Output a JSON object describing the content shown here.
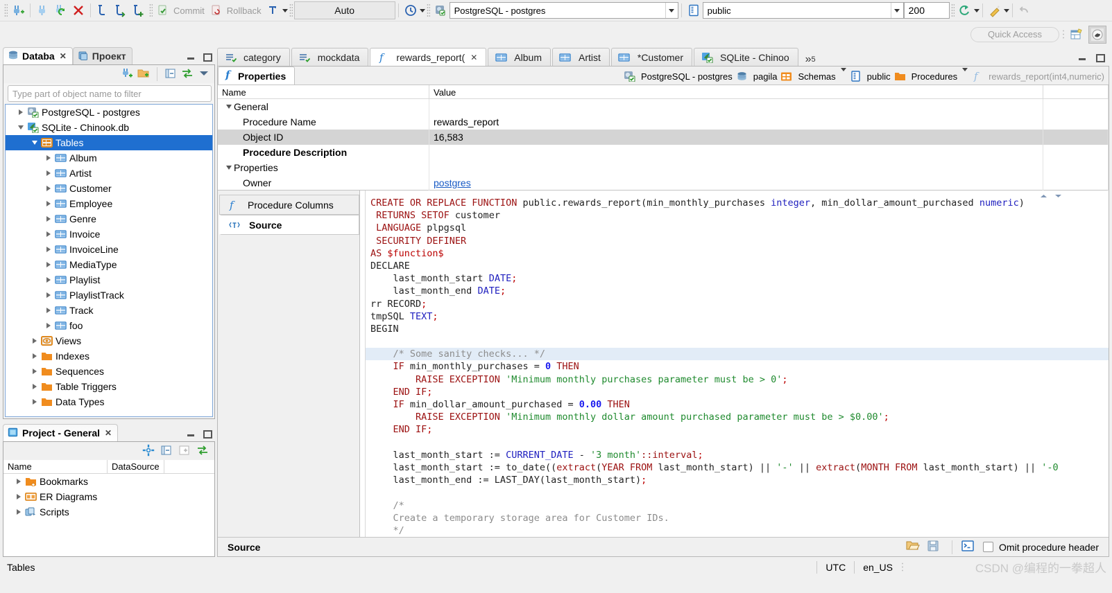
{
  "toolbar": {
    "icons": [
      "new-connection-icon",
      "connect-icon",
      "refresh-connection-icon",
      "disconnect-icon",
      "sql-editor-icon",
      "sql-editor-open-icon",
      "sql-editor-new-icon"
    ],
    "commit_label": "Commit",
    "rollback_label": "Rollback",
    "transaction_mode_icon": "transaction-mode-icon",
    "auto_commit_label": "Auto",
    "history_icon": "transaction-log-icon",
    "connection_value": "PostgreSQL - postgres",
    "schema_value": "public",
    "fetch_size_value": "200",
    "refresh_icon": "refresh-icon",
    "tools_icon": "tools-icon",
    "undo_icon": "undo-icon"
  },
  "quick_access": {
    "placeholder": "Quick Access",
    "open_perspective_icon": "open-perspective-icon",
    "perspective_icon": "dbeaver-perspective-icon"
  },
  "navigator": {
    "tabs": [
      {
        "label": "Databa",
        "icon": "database-navigator-icon",
        "active": true,
        "closable": true
      },
      {
        "label": "Проект",
        "icon": "project-explorer-icon",
        "active": false,
        "closable": false
      }
    ],
    "tools": [
      "new-connection-icon",
      "new-folder-icon",
      "collapse-all-icon",
      "link-with-editor-icon",
      "view-menu-icon"
    ],
    "filter_placeholder": "Type part of object name to filter",
    "tree": [
      {
        "label": "PostgreSQL - postgres",
        "indent": 0,
        "twisty": "right",
        "icon": "postgresql-connection-icon",
        "selected": false
      },
      {
        "label": "SQLite - Chinook.db",
        "indent": 0,
        "twisty": "down",
        "icon": "sqlite-connection-icon",
        "selected": false
      },
      {
        "label": "Tables",
        "indent": 1,
        "twisty": "down",
        "icon": "tables-folder-icon",
        "selected": true
      },
      {
        "label": "Album",
        "indent": 2,
        "twisty": "right",
        "icon": "table-icon",
        "selected": false
      },
      {
        "label": "Artist",
        "indent": 2,
        "twisty": "right",
        "icon": "table-icon",
        "selected": false
      },
      {
        "label": "Customer",
        "indent": 2,
        "twisty": "right",
        "icon": "table-icon",
        "selected": false
      },
      {
        "label": "Employee",
        "indent": 2,
        "twisty": "right",
        "icon": "table-icon",
        "selected": false
      },
      {
        "label": "Genre",
        "indent": 2,
        "twisty": "right",
        "icon": "table-icon",
        "selected": false
      },
      {
        "label": "Invoice",
        "indent": 2,
        "twisty": "right",
        "icon": "table-icon",
        "selected": false
      },
      {
        "label": "InvoiceLine",
        "indent": 2,
        "twisty": "right",
        "icon": "table-icon",
        "selected": false
      },
      {
        "label": "MediaType",
        "indent": 2,
        "twisty": "right",
        "icon": "table-icon",
        "selected": false
      },
      {
        "label": "Playlist",
        "indent": 2,
        "twisty": "right",
        "icon": "table-icon",
        "selected": false
      },
      {
        "label": "PlaylistTrack",
        "indent": 2,
        "twisty": "right",
        "icon": "table-icon",
        "selected": false
      },
      {
        "label": "Track",
        "indent": 2,
        "twisty": "right",
        "icon": "table-icon",
        "selected": false
      },
      {
        "label": "foo",
        "indent": 2,
        "twisty": "right",
        "icon": "table-icon",
        "selected": false
      },
      {
        "label": "Views",
        "indent": 1,
        "twisty": "right",
        "icon": "views-folder-icon",
        "selected": false
      },
      {
        "label": "Indexes",
        "indent": 1,
        "twisty": "right",
        "icon": "folder-icon",
        "selected": false
      },
      {
        "label": "Sequences",
        "indent": 1,
        "twisty": "right",
        "icon": "folder-icon",
        "selected": false
      },
      {
        "label": "Table Triggers",
        "indent": 1,
        "twisty": "right",
        "icon": "folder-icon",
        "selected": false
      },
      {
        "label": "Data Types",
        "indent": 1,
        "twisty": "right",
        "icon": "folder-icon",
        "selected": false
      }
    ]
  },
  "project": {
    "tab_label": "Project - General",
    "tab_icon": "project-icon",
    "tools": [
      "settings-gear-icon",
      "collapse-all-icon",
      "expand-all-icon",
      "link-with-editor-icon"
    ],
    "columns": [
      "Name",
      "DataSource"
    ],
    "tree": [
      {
        "label": "Bookmarks",
        "icon": "bookmarks-folder-icon"
      },
      {
        "label": "ER Diagrams",
        "icon": "er-diagram-icon"
      },
      {
        "label": "Scripts",
        "icon": "scripts-icon"
      }
    ]
  },
  "editor": {
    "tabs": [
      {
        "label": "category",
        "icon": "sql-script-icon",
        "active": false,
        "closable": false
      },
      {
        "label": "mockdata",
        "icon": "sql-script-icon",
        "active": false,
        "closable": false
      },
      {
        "label": "rewards_report(",
        "icon": "function-icon",
        "active": true,
        "closable": true
      },
      {
        "label": "Album",
        "icon": "table-icon",
        "active": false,
        "closable": false
      },
      {
        "label": "Artist",
        "icon": "table-icon",
        "active": false,
        "closable": false
      },
      {
        "label": "*Customer",
        "icon": "table-icon",
        "active": false,
        "closable": false
      },
      {
        "label": "SQLite - Chinoo",
        "icon": "sqlite-connection-icon",
        "active": false,
        "closable": false
      }
    ],
    "overflow_label": "5",
    "sub_tab": {
      "label": "Properties",
      "icon": "function-icon"
    },
    "breadcrumbs": [
      {
        "label": "PostgreSQL - postgres",
        "icon": "postgresql-connection-icon",
        "dim": false,
        "menu": false
      },
      {
        "label": "pagila",
        "icon": "database-icon",
        "dim": false,
        "menu": false
      },
      {
        "label": "Schemas",
        "icon": "schemas-icon",
        "dim": false,
        "menu": true
      },
      {
        "label": "public",
        "icon": "schema-icon",
        "dim": false,
        "menu": false
      },
      {
        "label": "Procedures",
        "icon": "folder-icon",
        "dim": false,
        "menu": true
      },
      {
        "label": "rewards_report(int4,numeric)",
        "icon": "function-icon",
        "dim": true,
        "menu": false
      }
    ],
    "properties": {
      "columns": [
        "Name",
        "Value"
      ],
      "rows": [
        {
          "name": "General",
          "value": "",
          "kind": "section",
          "alt": false
        },
        {
          "name": "Procedure Name",
          "value": "rewards_report",
          "kind": "item",
          "alt": false
        },
        {
          "name": "Object ID",
          "value": "16,583",
          "kind": "item",
          "alt": true
        },
        {
          "name": "Procedure Description",
          "value": "",
          "kind": "bold",
          "alt": false
        },
        {
          "name": "Properties",
          "value": "",
          "kind": "section",
          "alt": false
        },
        {
          "name": "Owner",
          "value": "postgres",
          "kind": "link",
          "alt": false
        }
      ]
    },
    "side_tabs": [
      {
        "label": "Procedure Columns",
        "icon": "function-icon",
        "active": false
      },
      {
        "label": "Source",
        "icon": "source-text-icon",
        "active": true
      }
    ],
    "footer": {
      "label": "Source",
      "icons": [
        "load-from-file-icon",
        "save-to-file-icon",
        "open-in-console-icon"
      ],
      "checkbox_label": "Omit procedure header",
      "checkbox_checked": false
    },
    "source_lines": [
      {
        "hl": false,
        "spans": [
          {
            "t": "CREATE OR REPLACE FUNCTION ",
            "c": "kw"
          },
          {
            "t": "public.rewards_report(min_monthly_purchases ",
            "c": "id"
          },
          {
            "t": "integer",
            "c": "typ"
          },
          {
            "t": ", min_dollar_amount_purchased ",
            "c": "id"
          },
          {
            "t": "numeric",
            "c": "typ"
          },
          {
            "t": ")",
            "c": "id"
          }
        ]
      },
      {
        "hl": false,
        "spans": [
          {
            "t": " RETURNS SETOF ",
            "c": "kw"
          },
          {
            "t": "customer",
            "c": "id"
          }
        ]
      },
      {
        "hl": false,
        "spans": [
          {
            "t": " LANGUAGE ",
            "c": "kw"
          },
          {
            "t": "plpgsql",
            "c": "id"
          }
        ]
      },
      {
        "hl": false,
        "spans": [
          {
            "t": " SECURITY DEFINER",
            "c": "kw"
          }
        ]
      },
      {
        "hl": false,
        "spans": [
          {
            "t": "AS ",
            "c": "kw"
          },
          {
            "t": "$function$",
            "c": "pun"
          }
        ]
      },
      {
        "hl": false,
        "spans": [
          {
            "t": "DECLARE",
            "c": "id"
          }
        ]
      },
      {
        "hl": false,
        "spans": [
          {
            "t": "    last_month_start ",
            "c": "id"
          },
          {
            "t": "DATE",
            "c": "typ"
          },
          {
            "t": ";",
            "c": "pun"
          }
        ]
      },
      {
        "hl": false,
        "spans": [
          {
            "t": "    last_month_end ",
            "c": "id"
          },
          {
            "t": "DATE",
            "c": "typ"
          },
          {
            "t": ";",
            "c": "pun"
          }
        ]
      },
      {
        "hl": false,
        "spans": [
          {
            "t": "rr RECORD",
            "c": "id"
          },
          {
            "t": ";",
            "c": "pun"
          }
        ]
      },
      {
        "hl": false,
        "spans": [
          {
            "t": "tmpSQL ",
            "c": "id"
          },
          {
            "t": "TEXT",
            "c": "typ"
          },
          {
            "t": ";",
            "c": "pun"
          }
        ]
      },
      {
        "hl": false,
        "spans": [
          {
            "t": "BEGIN",
            "c": "id"
          }
        ]
      },
      {
        "hl": false,
        "spans": [
          {
            "t": "",
            "c": "id"
          }
        ]
      },
      {
        "hl": true,
        "spans": [
          {
            "t": "    /* Some sanity checks... */",
            "c": "cmt"
          }
        ]
      },
      {
        "hl": false,
        "spans": [
          {
            "t": "    IF ",
            "c": "kw"
          },
          {
            "t": "min_monthly_purchases = ",
            "c": "id"
          },
          {
            "t": "0",
            "c": "num"
          },
          {
            "t": " THEN",
            "c": "kw"
          }
        ]
      },
      {
        "hl": false,
        "spans": [
          {
            "t": "        RAISE EXCEPTION ",
            "c": "kw"
          },
          {
            "t": "'Minimum monthly purchases parameter must be > 0'",
            "c": "str"
          },
          {
            "t": ";",
            "c": "pun"
          }
        ]
      },
      {
        "hl": false,
        "spans": [
          {
            "t": "    END IF",
            "c": "kw"
          },
          {
            "t": ";",
            "c": "pun"
          }
        ]
      },
      {
        "hl": false,
        "spans": [
          {
            "t": "    IF ",
            "c": "kw"
          },
          {
            "t": "min_dollar_amount_purchased = ",
            "c": "id"
          },
          {
            "t": "0.00",
            "c": "num"
          },
          {
            "t": " THEN",
            "c": "kw"
          }
        ]
      },
      {
        "hl": false,
        "spans": [
          {
            "t": "        RAISE EXCEPTION ",
            "c": "kw"
          },
          {
            "t": "'Minimum monthly dollar amount purchased parameter must be > $0.00'",
            "c": "str"
          },
          {
            "t": ";",
            "c": "pun"
          }
        ]
      },
      {
        "hl": false,
        "spans": [
          {
            "t": "    END IF",
            "c": "kw"
          },
          {
            "t": ";",
            "c": "pun"
          }
        ]
      },
      {
        "hl": false,
        "spans": [
          {
            "t": "",
            "c": "id"
          }
        ]
      },
      {
        "hl": false,
        "spans": [
          {
            "t": "    last_month_start := ",
            "c": "id"
          },
          {
            "t": "CURRENT_DATE",
            "c": "typ"
          },
          {
            "t": " - ",
            "c": "id"
          },
          {
            "t": "'3 month'",
            "c": "str"
          },
          {
            "t": "::interval",
            "c": "kw"
          },
          {
            "t": ";",
            "c": "pun"
          }
        ]
      },
      {
        "hl": false,
        "spans": [
          {
            "t": "    last_month_start := to_date((",
            "c": "id"
          },
          {
            "t": "extract",
            "c": "kw"
          },
          {
            "t": "(",
            "c": "id"
          },
          {
            "t": "YEAR FROM",
            "c": "kw"
          },
          {
            "t": " last_month_start) || ",
            "c": "id"
          },
          {
            "t": "'-'",
            "c": "str"
          },
          {
            "t": " || ",
            "c": "id"
          },
          {
            "t": "extract",
            "c": "kw"
          },
          {
            "t": "(",
            "c": "id"
          },
          {
            "t": "MONTH FROM",
            "c": "kw"
          },
          {
            "t": " last_month_start) || ",
            "c": "id"
          },
          {
            "t": "'-0",
            "c": "str"
          }
        ]
      },
      {
        "hl": false,
        "spans": [
          {
            "t": "    last_month_end := LAST_DAY(last_month_start)",
            "c": "id"
          },
          {
            "t": ";",
            "c": "pun"
          }
        ]
      },
      {
        "hl": false,
        "spans": [
          {
            "t": "",
            "c": "id"
          }
        ]
      },
      {
        "hl": false,
        "spans": [
          {
            "t": "    /*",
            "c": "cmt"
          }
        ]
      },
      {
        "hl": false,
        "spans": [
          {
            "t": "    Create a temporary storage area for Customer IDs.",
            "c": "cmt"
          }
        ]
      },
      {
        "hl": false,
        "spans": [
          {
            "t": "    */",
            "c": "cmt"
          }
        ]
      }
    ]
  },
  "statusbar": {
    "left_text": "Tables",
    "timezone": "UTC",
    "locale": "en_US",
    "watermark": "CSDN @编程的一拳超人"
  }
}
